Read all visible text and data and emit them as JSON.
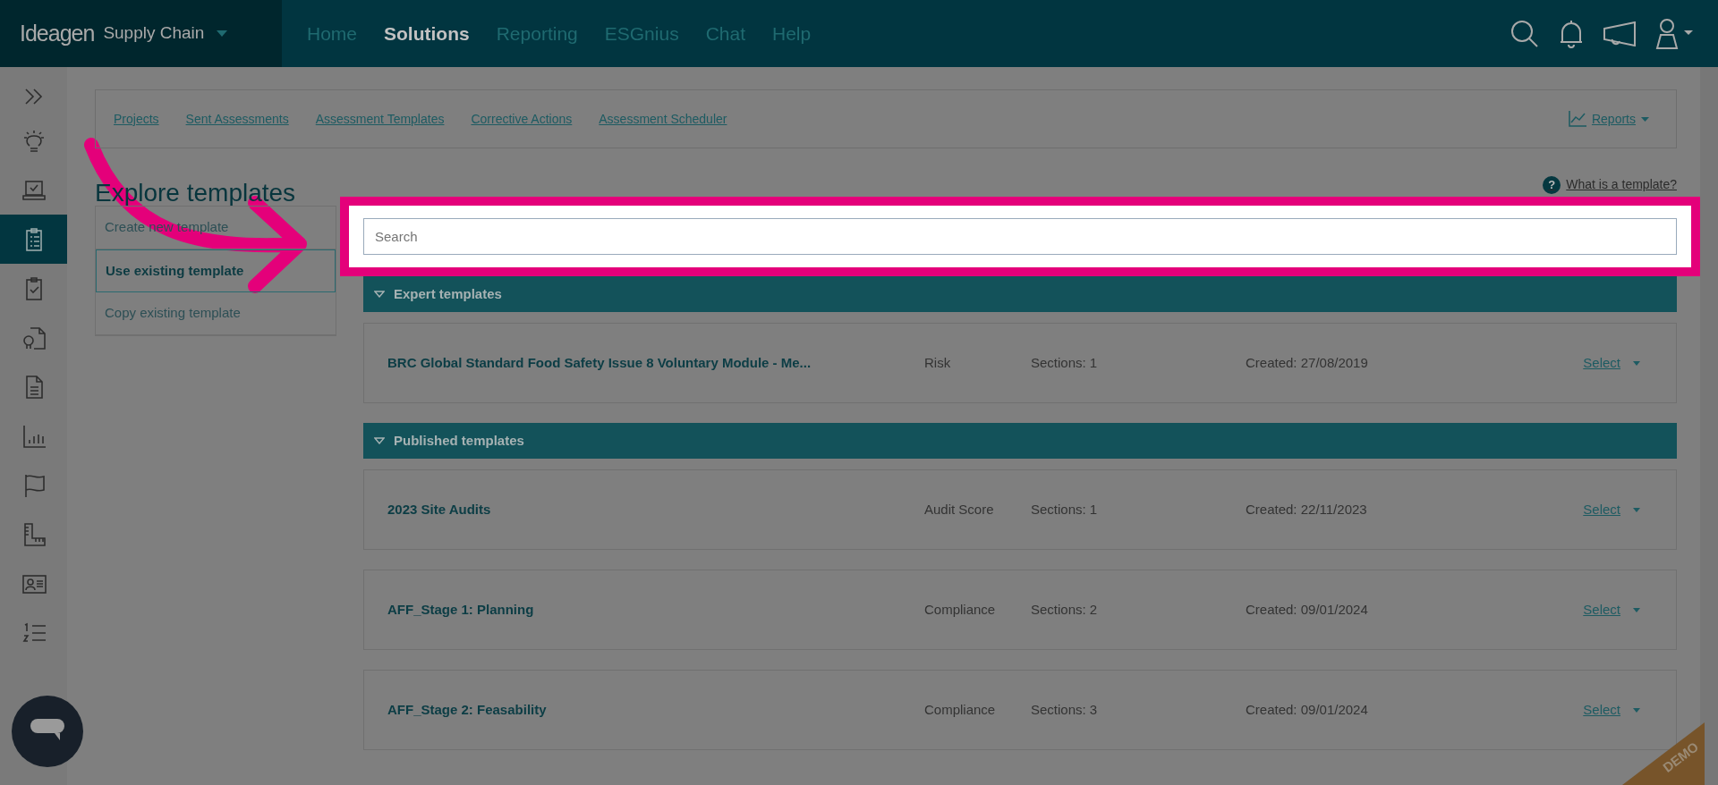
{
  "header": {
    "logo": "Ideagen",
    "product": "Supply Chain",
    "nav": [
      {
        "label": "Home",
        "selected": false
      },
      {
        "label": "Solutions",
        "selected": true
      },
      {
        "label": "Reporting",
        "selected": false
      },
      {
        "label": "ESGnius",
        "selected": false
      },
      {
        "label": "Chat",
        "selected": false
      },
      {
        "label": "Help",
        "selected": false
      }
    ]
  },
  "sidebar": {
    "items": [
      {
        "kind": "bulb",
        "selected": false
      },
      {
        "kind": "laptop",
        "selected": false
      },
      {
        "kind": "clipboard-list",
        "selected": true
      },
      {
        "kind": "clipboard-check",
        "selected": false
      },
      {
        "kind": "doc-award",
        "selected": false
      },
      {
        "kind": "document",
        "selected": false
      },
      {
        "kind": "bars",
        "selected": false
      },
      {
        "kind": "flag",
        "selected": false
      },
      {
        "kind": "ruler",
        "selected": false
      },
      {
        "kind": "id-card",
        "selected": false
      },
      {
        "kind": "numbered",
        "selected": false
      }
    ]
  },
  "subnav": {
    "links": [
      "Projects",
      "Sent Assessments",
      "Assessment Templates",
      "Corrective Actions",
      "Assessment Scheduler"
    ],
    "reports": "Reports"
  },
  "page_title": "Explore templates",
  "help_icon": "?",
  "help_link": "What is a template?",
  "menu": [
    {
      "label": "Create new template",
      "selected": false
    },
    {
      "label": "Use existing template",
      "selected": true
    },
    {
      "label": "Copy existing template",
      "selected": false
    }
  ],
  "search": {
    "placeholder": "Search"
  },
  "sections": [
    {
      "title": "Expert templates",
      "rows": [
        {
          "name": "BRC Global Standard Food Safety Issue 8 Voluntary Module - Me...",
          "type": "Risk",
          "sections": "Sections: 1",
          "created": "Created: 27/08/2019",
          "action": "Select"
        }
      ]
    },
    {
      "title": "Published templates",
      "rows": [
        {
          "name": "2023 Site Audits",
          "type": "Audit Score",
          "sections": "Sections: 1",
          "created": "Created: 22/11/2023",
          "action": "Select"
        },
        {
          "name": "AFF_Stage 1: Planning",
          "type": "Compliance",
          "sections": "Sections: 2",
          "created": "Created: 09/01/2024",
          "action": "Select"
        },
        {
          "name": "AFF_Stage 2: Feasability",
          "type": "Compliance",
          "sections": "Sections: 3",
          "created": "Created: 09/01/2024",
          "action": "Select"
        }
      ]
    }
  ],
  "ribbon": "DEMO"
}
